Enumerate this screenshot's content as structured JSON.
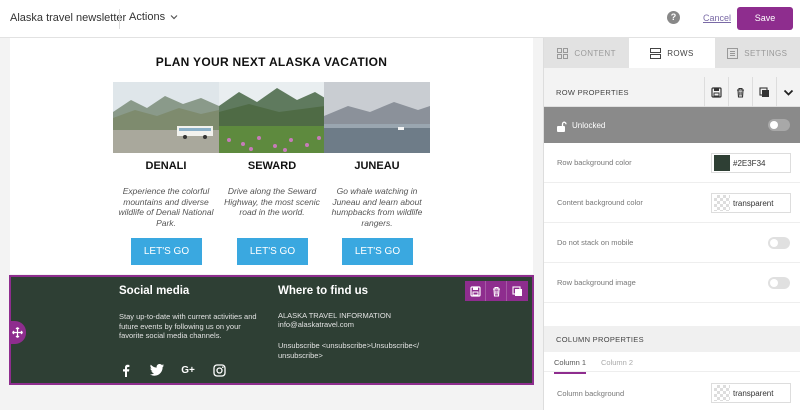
{
  "topbar": {
    "title": "Alaska travel newsletter",
    "actions_label": "Actions",
    "help_glyph": "?",
    "cancel_label": "Cancel",
    "save_label": "Save"
  },
  "newsletter": {
    "heading": "PLAN YOUR NEXT ALASKA VACATION",
    "columns": [
      {
        "name": "DENALI",
        "description": "Experience the colorful mountains and diverse wildlife of Denali National Park.",
        "button": "LET'S GO"
      },
      {
        "name": "SEWARD",
        "description": "Drive along the Seward Highway, the most scenic road in the world.",
        "button": "LET'S GO"
      },
      {
        "name": "JUNEAU",
        "description": "Go whale watching in Juneau and learn about humpbacks from wildlife rangers.",
        "button": "LET'S GO"
      }
    ],
    "footer": {
      "social_title": "Social media",
      "social_text": "Stay up-to-date with current activities and future events by following us on your favorite social media channels.",
      "find_title": "Where to find us",
      "find_line1": "ALASKA TRAVEL INFORMATION",
      "find_line2": "info@alaskatravel.com",
      "unsubscribe": "Unsubscribe <unsubscribe>Unsubscribe</ unsubscribe>",
      "social_icons": [
        "facebook-icon",
        "twitter-icon",
        "google-plus-icon",
        "instagram-icon"
      ],
      "gplus_glyph": "G+"
    }
  },
  "panel": {
    "tabs": [
      {
        "label": "CONTENT",
        "icon": "grid-icon"
      },
      {
        "label": "ROWS",
        "icon": "rows-icon"
      },
      {
        "label": "SETTINGS",
        "icon": "settings-icon"
      }
    ],
    "active_tab": "ROWS",
    "row_properties_label": "ROW PROPERTIES",
    "unlocked_label": "Unlocked",
    "props": {
      "row_bg_label": "Row background color",
      "row_bg_value": "#2E3F34",
      "content_bg_label": "Content background color",
      "content_bg_value": "transparent",
      "stack_label": "Do not stack on mobile",
      "row_image_label": "Row background image"
    },
    "column_properties_label": "COLUMN PROPERTIES",
    "column_tabs": [
      "Column 1",
      "Column 2"
    ],
    "column_bg_label": "Column background",
    "column_bg_value": "transparent"
  },
  "colors": {
    "accent": "#8e2d8e",
    "button_blue": "#3aa8e0",
    "footer_bg": "#2e3f34"
  }
}
